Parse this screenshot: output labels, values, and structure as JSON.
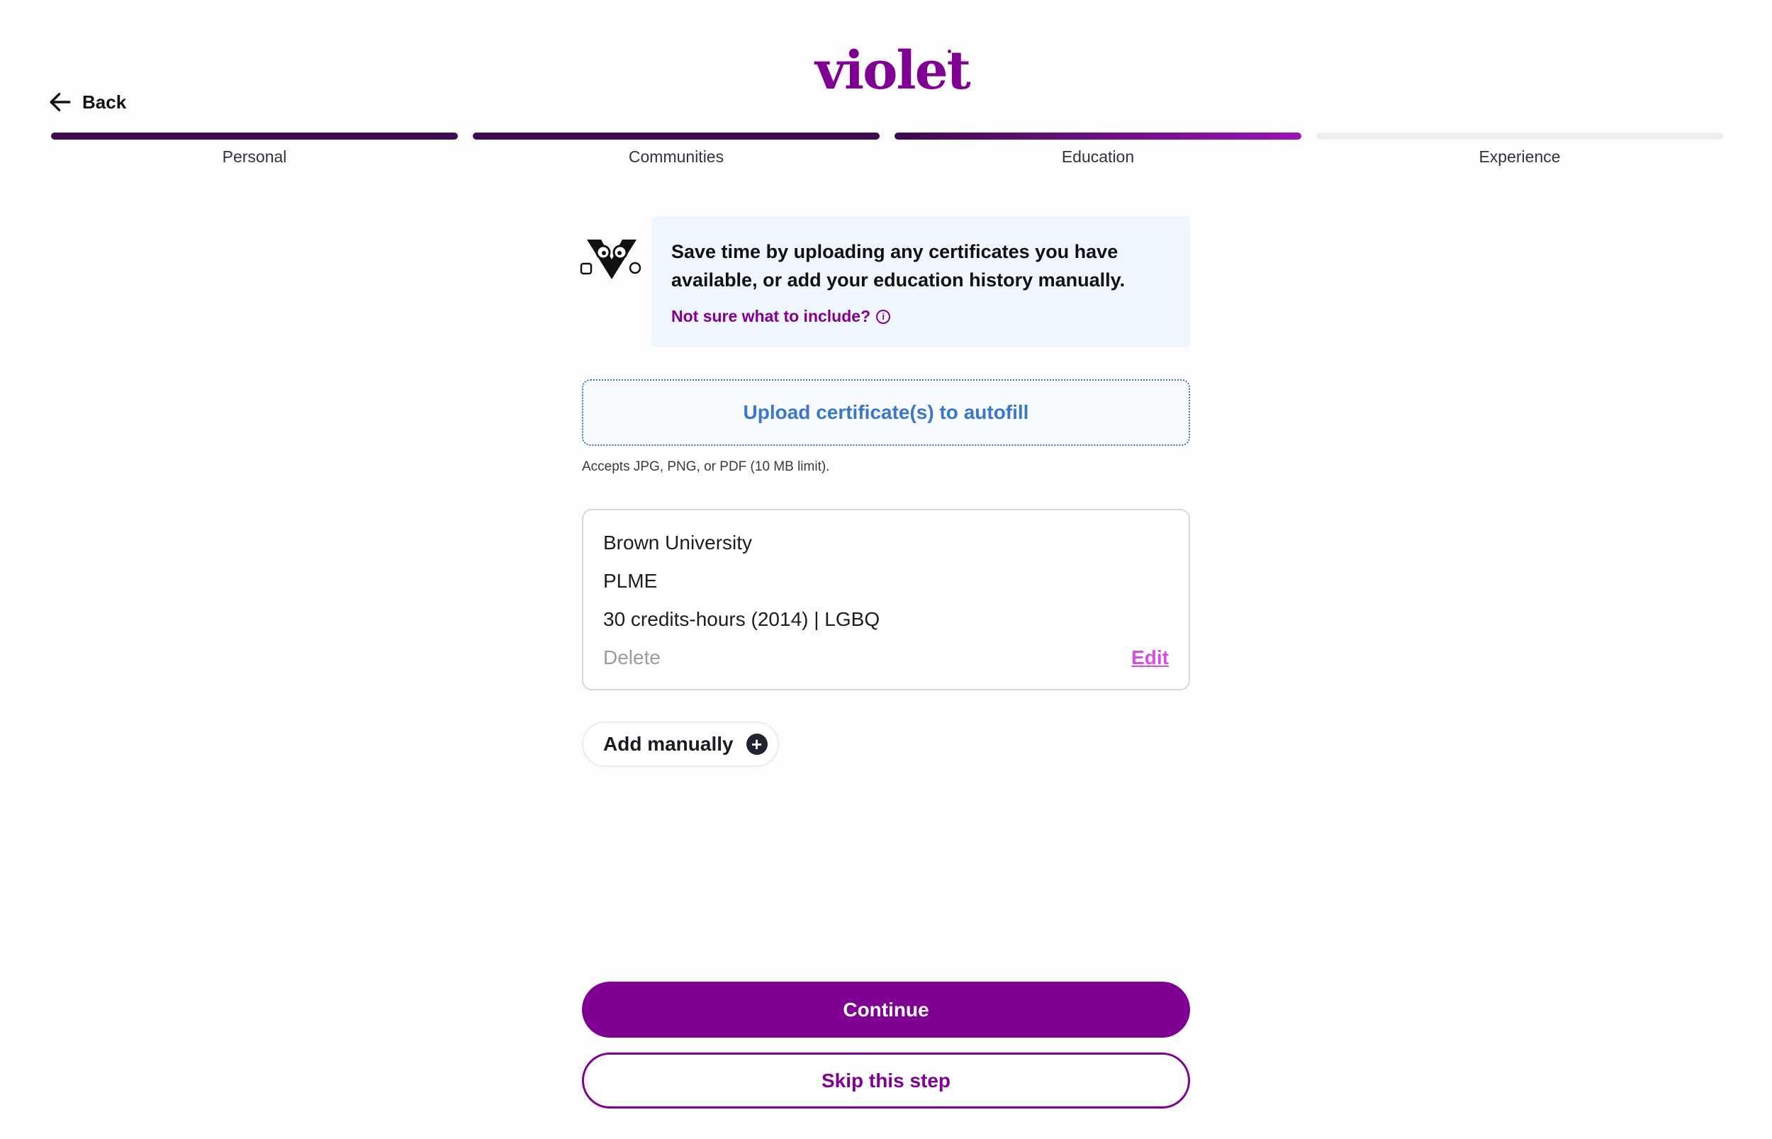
{
  "brand": {
    "logo_text": "violet",
    "color": "#800094"
  },
  "nav": {
    "back_label": "Back",
    "back_icon": "arrow-left-icon"
  },
  "progress": {
    "steps": [
      {
        "label": "Personal",
        "state": "complete"
      },
      {
        "label": "Communities",
        "state": "complete"
      },
      {
        "label": "Education",
        "state": "current"
      },
      {
        "label": "Experience",
        "state": "upcoming"
      }
    ],
    "colors": {
      "complete": "#3e0b4c",
      "current_start": "#3e0b4c",
      "current_end": "#9a12b7",
      "upcoming": "#ececf1"
    }
  },
  "info": {
    "text": "Save time by uploading any certificates you have available, or add your education history manually.",
    "link_label": "Not sure what to include?",
    "link_icon": "info-circle-icon",
    "background": "#eff6ff"
  },
  "upload": {
    "label": "Upload certificate(s) to autofill",
    "hint": "Accepts JPG, PNG, or PDF (10 MB limit)."
  },
  "education_entries": [
    {
      "institution": "Brown University",
      "program": "PLME",
      "details": "30 credits-hours (2014) | LGBQ",
      "delete_label": "Delete",
      "edit_label": "Edit"
    }
  ],
  "add_manually": {
    "label": "Add manually",
    "icon": "plus-circle-icon"
  },
  "actions": {
    "continue_label": "Continue",
    "skip_label": "Skip this step"
  }
}
